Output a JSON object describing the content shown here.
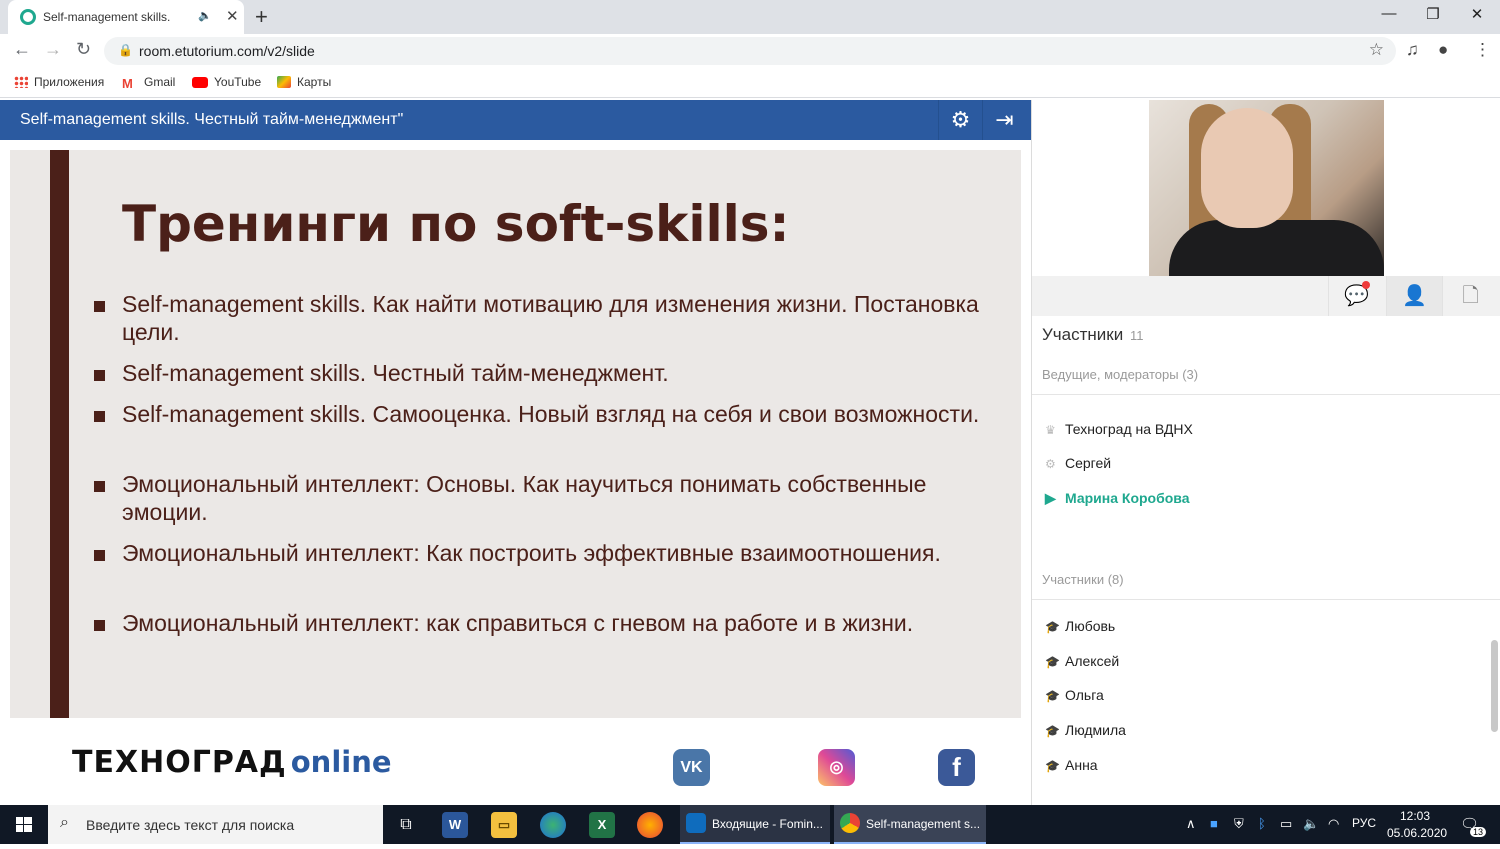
{
  "browser": {
    "tab_title": "Self-management skills. Чест",
    "tab_speaker": "🔈",
    "tab_close": "✕",
    "new_tab": "+",
    "url": "room.etutorium.com/v2/slide",
    "window_controls": [
      "—",
      "❐",
      "✕"
    ]
  },
  "bookmarks": [
    {
      "label": "Приложения",
      "icon": "apps-grid-icon"
    },
    {
      "label": "Gmail",
      "icon": "gmail-icon"
    },
    {
      "label": "YouTube",
      "icon": "youtube-icon"
    },
    {
      "label": "Карты",
      "icon": "maps-icon"
    }
  ],
  "app": {
    "header_title": "Self-management skills. Честный тайм-менеджмент\"",
    "settings_icon": "⚙",
    "exit_icon": "⇥"
  },
  "slide": {
    "heading": "Тренинги по soft-skills:",
    "bullets": [
      "Self-management skills. Как найти мотивацию для изменения жизни. Постановка цели.",
      "Self-management skills. Честный тайм-менеджмент.",
      "Self-management skills. Самооценка. Новый взгляд на себя и свои возможности.",
      "Эмоциональный интеллект: Основы. Как научиться понимать собственные эмоции.",
      "Эмоциональный интеллект: Как построить эффективные взаимоотношения.",
      "Эмоциональный интеллект: как справиться с гневом на работе и в жизни."
    ],
    "colors": {
      "accent": "#4b2019",
      "background": "#ebe8e6"
    }
  },
  "footer": {
    "logo_main": "ТЕХНОГРАД",
    "logo_suffix": "online",
    "social": [
      {
        "name": "vk-icon",
        "glyph": "VK",
        "color": "#4a76a8"
      },
      {
        "name": "instagram-icon",
        "glyph": "◎",
        "color": "#d6249f"
      },
      {
        "name": "facebook-icon",
        "glyph": "f",
        "color": "#3b5998"
      }
    ]
  },
  "panel": {
    "participants_title": "Участники",
    "participants_count": "11",
    "hosts_label": "Ведущие, модераторы (3)",
    "hosts": [
      {
        "name": "Техноград на ВДНХ",
        "icon": "♛"
      },
      {
        "name": "Сергей",
        "icon": "⚙"
      },
      {
        "name": "Марина Коробова",
        "icon": "▶"
      }
    ],
    "members_label": "Участники (8)",
    "members": [
      "Любовь",
      "Алексей",
      "Ольга",
      "Людмила",
      "Анна"
    ],
    "member_icon": "🎓",
    "chat_icon": "💬",
    "user_icon": "👤",
    "file_icon": "🗋"
  },
  "taskbar": {
    "search_placeholder": "Введите здесь текст для поиска",
    "apps": [
      {
        "label": "Входящие - Fomin...",
        "color": "#0f6cbd"
      },
      {
        "label": "Self-management s...",
        "color": "#4caf50"
      }
    ],
    "language": "РУС",
    "time": "12:03",
    "date": "05.06.2020",
    "notifications": "13"
  }
}
